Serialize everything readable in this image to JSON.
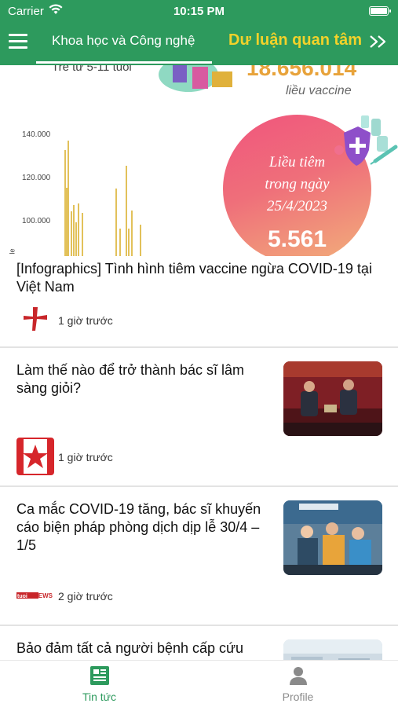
{
  "status_bar": {
    "carrier": "Carrier",
    "time": "10:15 PM"
  },
  "nav": {
    "tabs": [
      {
        "label": "Khoa học và Công nghệ",
        "selected": true
      },
      {
        "label": "Dư luận quan tâm",
        "selected": false
      }
    ],
    "menu_icon": "hamburger-icon",
    "more_icon": "double-chevron-right-icon"
  },
  "hero": {
    "snippet": "Trẻ từ 5-11 tuổi",
    "total_doses": "18.656.014",
    "total_unit": "liều vaccine",
    "daily_title_line1": "Liều tiêm",
    "daily_title_line2": "trong ngày",
    "daily_date": "25/4/2023",
    "daily_value": "5.561",
    "chart_ticks": [
      "140.000",
      "120.000",
      "100.000"
    ],
    "chart_axis_hint": "le"
  },
  "articles": [
    {
      "title": "[Infographics] Tình hình tiêm vaccine ngừa COVID-19 tại Việt Nam",
      "time": "1 giờ trước",
      "source_icon": "red-cross-logo-icon"
    },
    {
      "title": "Làm thế nào để trở thành bác sĩ lâm sàng giỏi?",
      "time": "1 giờ trước",
      "source_icon": "red-star-logo-icon"
    },
    {
      "title": "Ca mắc COVID-19 tăng, bác sĩ khuyến cáo biện pháp phòng dịch dịp lễ 30/4 – 1/5",
      "time": "2 giờ trước",
      "source_icon": "news-logo-icon"
    },
    {
      "title": "Bảo đảm tất cả người bệnh cấp cứu",
      "time": "",
      "source_icon": ""
    }
  ],
  "tabbar": [
    {
      "label": "Tin tức",
      "icon": "newspaper-icon",
      "active": true
    },
    {
      "label": "Profile",
      "icon": "person-icon",
      "active": false
    }
  ],
  "colors": {
    "primary": "#2d9a5d",
    "accent_yellow": "#f2d22a",
    "chart_bar": "#e2c15a",
    "pink": "#f0557d"
  }
}
